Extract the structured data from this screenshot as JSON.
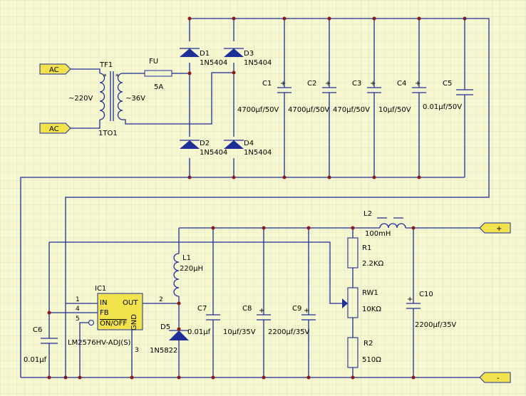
{
  "colors": {
    "background": "#f6f6cf",
    "grid": "#c9d3cc",
    "wire": "#1f2f9a",
    "node": "#8b1a1a",
    "port": "#f2e24b"
  },
  "ports": {
    "ac_top": "AC",
    "ac_bottom": "AC",
    "plus": "+",
    "minus": "-"
  },
  "transformer": {
    "ref": "TF1",
    "part": "1TO1",
    "primary": "~220V",
    "secondary": "~36V"
  },
  "fuse": {
    "ref": "FU",
    "value": "5A"
  },
  "diodes": [
    {
      "ref": "D1",
      "part": "1N5404"
    },
    {
      "ref": "D3",
      "part": "1N5404"
    },
    {
      "ref": "D2",
      "part": "1N5404"
    },
    {
      "ref": "D4",
      "part": "1N5404"
    }
  ],
  "caps_top": [
    {
      "ref": "C1",
      "value": "4700μf/50V"
    },
    {
      "ref": "C2",
      "value": "4700μf/50V"
    },
    {
      "ref": "C3",
      "value": "470μf/50V"
    },
    {
      "ref": "C4",
      "value": "10μf/50V"
    },
    {
      "ref": "C5",
      "value": "0.01μf/50V"
    }
  ],
  "ic": {
    "ref": "IC1",
    "part": "LM2576HV-ADJ(S)",
    "in": "IN",
    "fb": "FB",
    "onoff": "ON/OFF",
    "out": "OUT",
    "gnd": "GND",
    "pin1": "1",
    "pin2": "2",
    "pin3": "3",
    "pin4": "4",
    "pin5": "5"
  },
  "c6": {
    "ref": "C6",
    "value": "0.01μf"
  },
  "l1": {
    "ref": "L1",
    "value": "220μH"
  },
  "d5": {
    "ref": "D5",
    "part": "1N5822"
  },
  "c7": {
    "ref": "C7",
    "value": "0.01μf"
  },
  "c8": {
    "ref": "C8",
    "value": "10μf/35V"
  },
  "c9": {
    "ref": "C9",
    "value": "2200μf/35V"
  },
  "l2": {
    "ref": "L2",
    "value": "100mH"
  },
  "r1": {
    "ref": "R1",
    "value": "2.2KΩ"
  },
  "rw1": {
    "ref": "RW1",
    "value": "10KΩ"
  },
  "r2": {
    "ref": "R2",
    "value": "510Ω"
  },
  "c10": {
    "ref": "C10",
    "value": "2200μf/35V"
  }
}
